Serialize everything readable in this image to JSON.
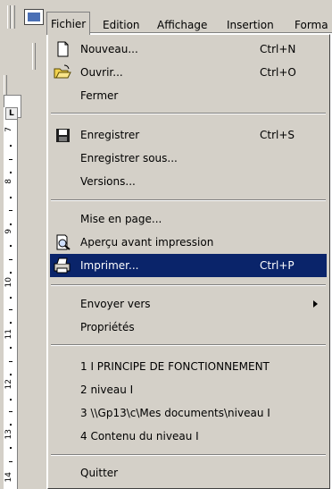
{
  "menubar": {
    "items": [
      "Fichier",
      "Edition",
      "Affichage",
      "Insertion",
      "Forma"
    ]
  },
  "ruler": {
    "numbers": [
      "7",
      "8",
      "9",
      "10",
      "11",
      "12",
      "13",
      "14"
    ]
  },
  "menu": {
    "items": [
      {
        "label": "Nouveau...",
        "shortcut": "Ctrl+N",
        "icon": "new-document-icon"
      },
      {
        "label": "Ouvrir...",
        "shortcut": "Ctrl+O",
        "icon": "open-folder-icon"
      },
      {
        "label": "Fermer"
      },
      {
        "label": "Enregistrer",
        "shortcut": "Ctrl+S",
        "icon": "save-disk-icon"
      },
      {
        "label": "Enregistrer sous..."
      },
      {
        "label": "Versions..."
      },
      {
        "label": "Mise en page..."
      },
      {
        "label": "Aperçu avant impression",
        "icon": "print-preview-icon"
      },
      {
        "label": "Imprimer...",
        "shortcut": "Ctrl+P",
        "icon": "printer-icon",
        "highlighted": true
      },
      {
        "label": "Envoyer vers",
        "submenu": true
      },
      {
        "label": "Propriétés"
      },
      {
        "label": "1 I PRINCIPE DE FONCTIONNEMENT"
      },
      {
        "label": "2 niveau I"
      },
      {
        "label": "3 \\\\Gp13\\c\\Mes documents\\niveau I"
      },
      {
        "label": "4 Contenu du niveau I"
      },
      {
        "label": "Quitter"
      }
    ]
  },
  "colors": {
    "menu_background": "#d4d0c8",
    "highlight": "#0a246a",
    "highlight_text": "#ffffff"
  }
}
